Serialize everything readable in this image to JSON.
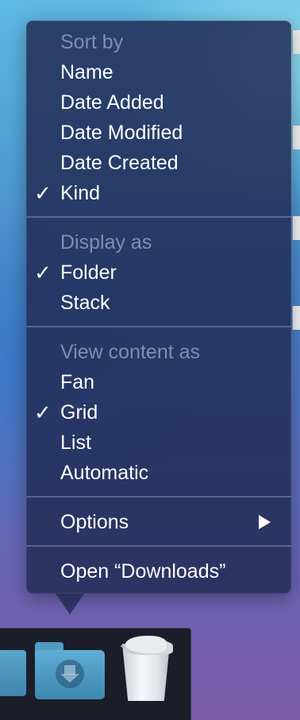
{
  "menu": {
    "sort_by": {
      "header": "Sort by",
      "items": [
        {
          "label": "Name",
          "checked": false
        },
        {
          "label": "Date Added",
          "checked": false
        },
        {
          "label": "Date Modified",
          "checked": false
        },
        {
          "label": "Date Created",
          "checked": false
        },
        {
          "label": "Kind",
          "checked": true
        }
      ]
    },
    "display_as": {
      "header": "Display as",
      "items": [
        {
          "label": "Folder",
          "checked": true
        },
        {
          "label": "Stack",
          "checked": false
        }
      ]
    },
    "view_content_as": {
      "header": "View content as",
      "items": [
        {
          "label": "Fan",
          "checked": false
        },
        {
          "label": "Grid",
          "checked": true
        },
        {
          "label": "List",
          "checked": false
        },
        {
          "label": "Automatic",
          "checked": false
        }
      ]
    },
    "options_label": "Options",
    "open_label": "Open “Downloads”",
    "checkmark": "✓"
  },
  "dock": {
    "icons": [
      "folder-icon",
      "downloads-folder-icon",
      "trash-icon"
    ]
  }
}
